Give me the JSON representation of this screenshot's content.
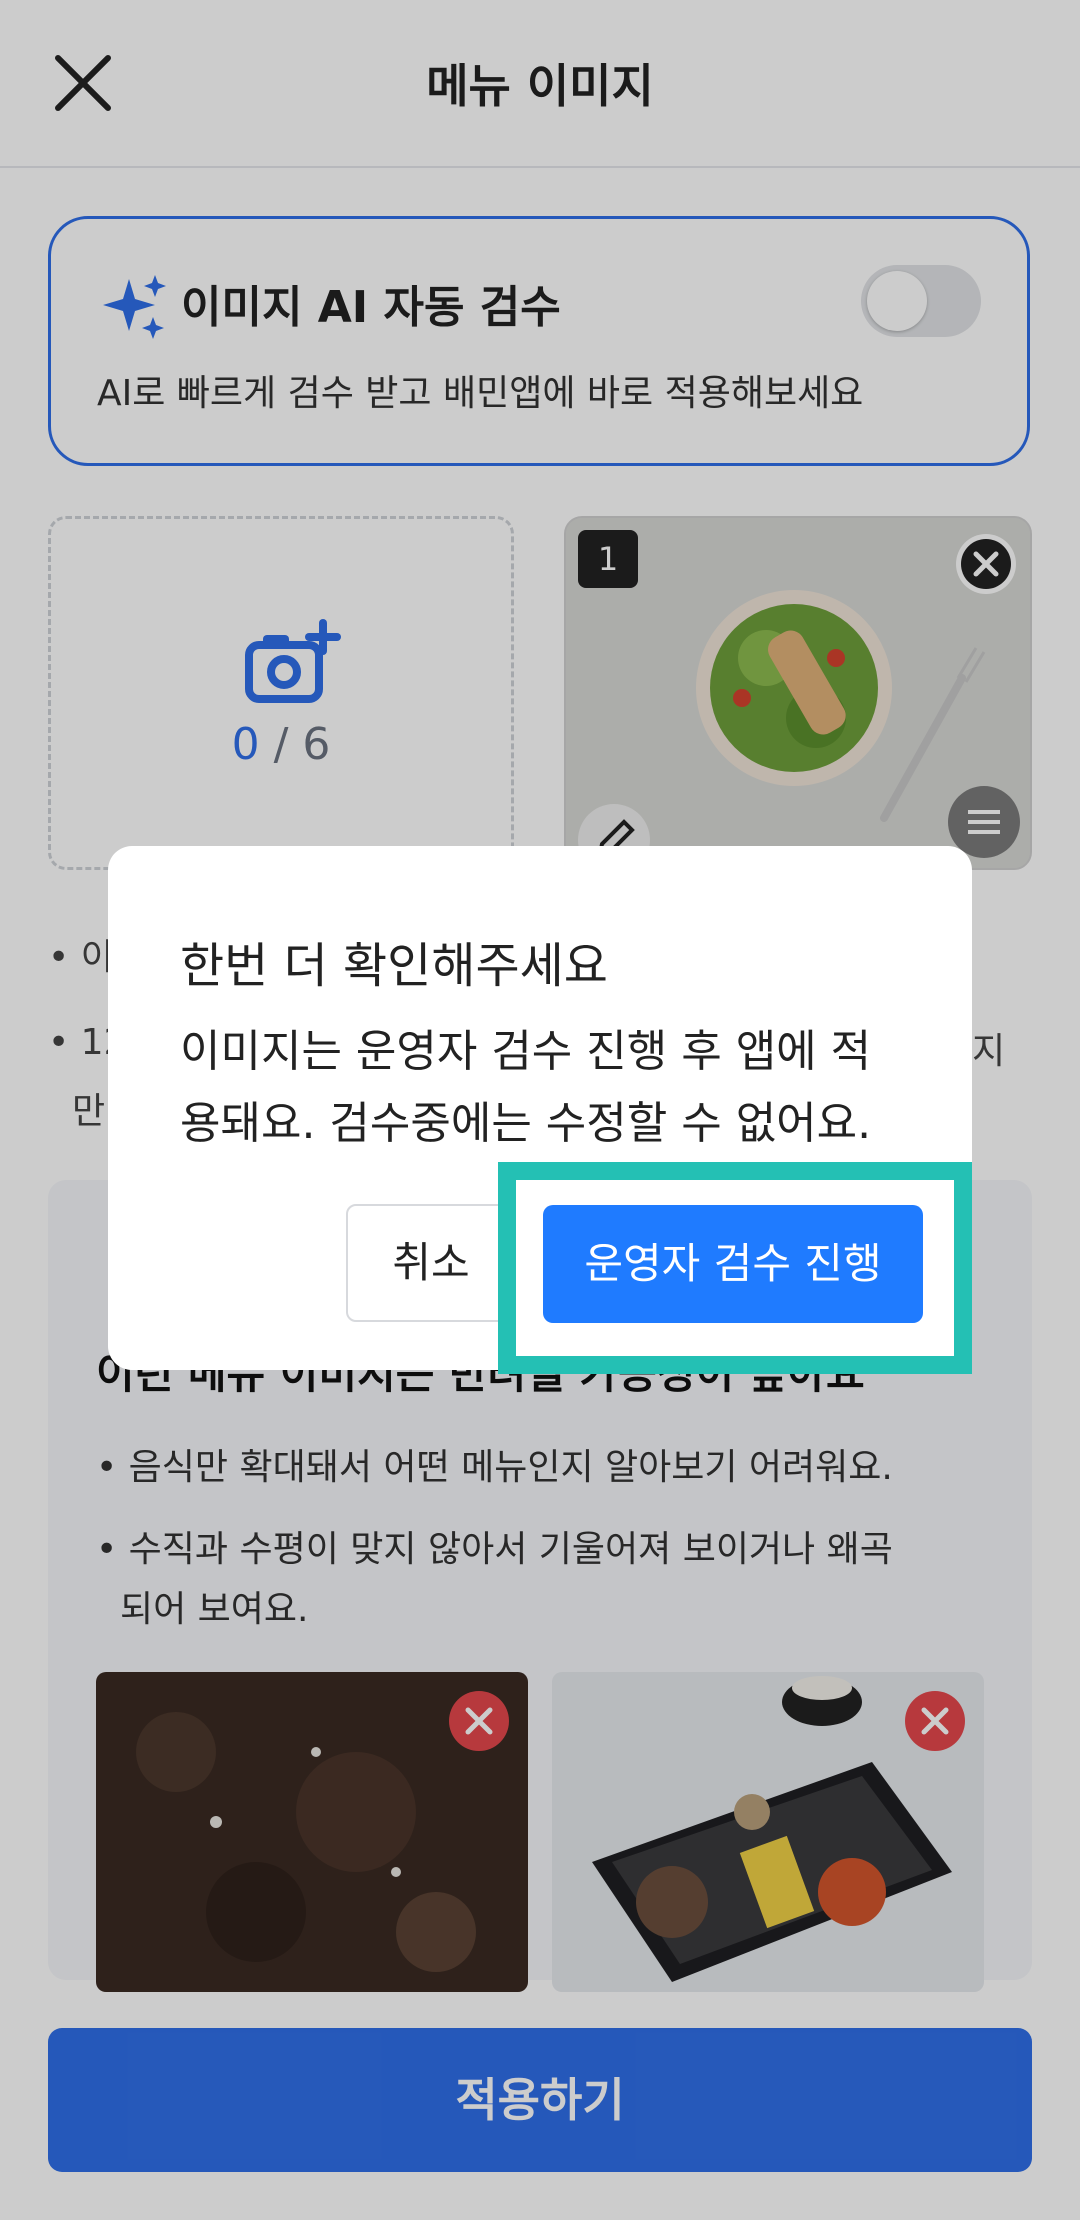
{
  "header": {
    "title": "메뉴 이미지",
    "close_icon": "close-icon"
  },
  "ai_review": {
    "title": "이미지 AI 자동 검수",
    "subtitle": "AI로 빠르게 검수 받고 배민앱에 바로 적용해보세요",
    "toggle_state": "off",
    "icon": "sparkle-icon",
    "accent_color": "#2f6fe9"
  },
  "upload": {
    "count_current": "0",
    "count_separator": "/",
    "count_max": "6",
    "icon": "camera-add-icon"
  },
  "photo": {
    "index": "1",
    "remove_icon": "close-circle-icon",
    "edit_icon": "pencil-icon",
    "menu_icon": "menu-icon"
  },
  "tips": {
    "line1": "• 이",
    "line2a": "• 12",
    "line2b": "만",
    "line2c": "지"
  },
  "guide": {
    "heading": "이런 메뉴 이미지는 반려될 가능성이 높아요",
    "bullet1": "• 음식만 확대돼서 어떤 메뉴인지 알아보기 어려워요.",
    "bullet2a": "• 수직과 수평이 맞지 않아서 기울어져 보이거나 왜곡",
    "bullet2b": "되어 보여요."
  },
  "apply_button": "적용하기",
  "dialog": {
    "title": "한번 더 확인해주세요",
    "body_line1": "이미지는 운영자 검수 진행 후 앱에 적",
    "body_line2": "용돼요. 검수중에는 수정할 수 없어요.",
    "cancel": "취소",
    "confirm": "운영자 검수 진행",
    "confirm_color": "#1f7bff",
    "highlight_color": "#24c0b4"
  }
}
